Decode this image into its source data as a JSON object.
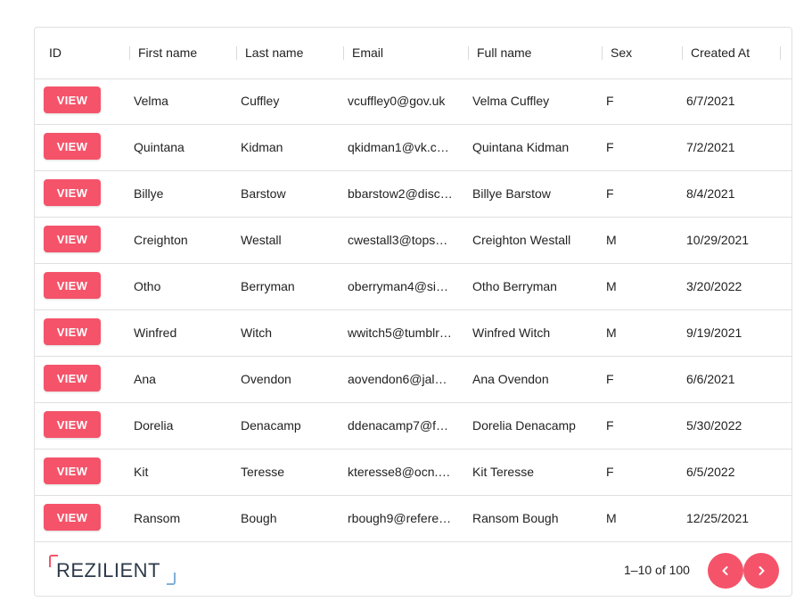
{
  "columns": {
    "id": "ID",
    "first_name": "First name",
    "last_name": "Last name",
    "email": "Email",
    "full_name": "Full name",
    "sex": "Sex",
    "created_at": "Created At"
  },
  "view_label": "VIEW",
  "rows": [
    {
      "first_name": "Velma",
      "last_name": "Cuffley",
      "email": "vcuffley0@gov.uk",
      "full_name": "Velma Cuffley",
      "sex": "F",
      "created_at": "6/7/2021"
    },
    {
      "first_name": "Quintana",
      "last_name": "Kidman",
      "email": "qkidman1@vk.c…",
      "full_name": "Quintana Kidman",
      "sex": "F",
      "created_at": "7/2/2021"
    },
    {
      "first_name": "Billye",
      "last_name": "Barstow",
      "email": "bbarstow2@disc…",
      "full_name": "Billye Barstow",
      "sex": "F",
      "created_at": "8/4/2021"
    },
    {
      "first_name": "Creighton",
      "last_name": "Westall",
      "email": "cwestall3@tops…",
      "full_name": "Creighton Westall",
      "sex": "M",
      "created_at": "10/29/2021"
    },
    {
      "first_name": "Otho",
      "last_name": "Berryman",
      "email": "oberryman4@si…",
      "full_name": "Otho Berryman",
      "sex": "M",
      "created_at": "3/20/2022"
    },
    {
      "first_name": "Winfred",
      "last_name": "Witch",
      "email": "wwitch5@tumblr…",
      "full_name": "Winfred Witch",
      "sex": "M",
      "created_at": "9/19/2021"
    },
    {
      "first_name": "Ana",
      "last_name": "Ovendon",
      "email": "aovendon6@jal…",
      "full_name": "Ana Ovendon",
      "sex": "F",
      "created_at": "6/6/2021"
    },
    {
      "first_name": "Dorelia",
      "last_name": "Denacamp",
      "email": "ddenacamp7@f…",
      "full_name": "Dorelia Denacamp",
      "sex": "F",
      "created_at": "5/30/2022"
    },
    {
      "first_name": "Kit",
      "last_name": "Teresse",
      "email": "kteresse8@ocn.…",
      "full_name": "Kit Teresse",
      "sex": "F",
      "created_at": "6/5/2022"
    },
    {
      "first_name": "Ransom",
      "last_name": "Bough",
      "email": "rbough9@refere…",
      "full_name": "Ransom Bough",
      "sex": "M",
      "created_at": "12/25/2021"
    }
  ],
  "footer": {
    "logo_text": "REZILIENT",
    "pagination": "1–10 of 100",
    "prev_icon": "chevron-left-icon",
    "next_icon": "chevron-right-icon"
  },
  "colors": {
    "accent": "#f5536a",
    "logo_secondary": "#7fb0d8",
    "border": "#e0e0e0"
  }
}
